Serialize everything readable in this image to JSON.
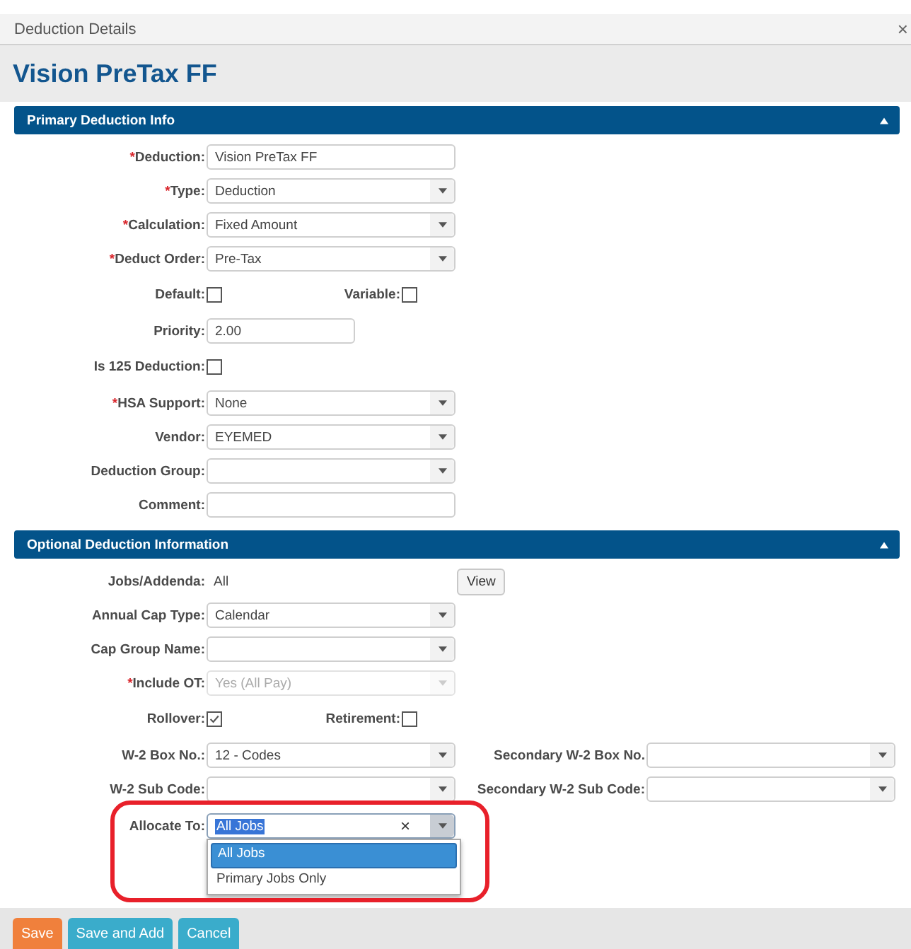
{
  "dialog": {
    "title": "Deduction Details",
    "close": "×"
  },
  "header": "Vision PreTax FF",
  "sections": [
    {
      "title": "Primary Deduction Info",
      "expanded": true,
      "rows": [
        {
          "kind": "text",
          "label": "Deduction:",
          "required_mark": "*",
          "value": "Vision PreTax FF"
        },
        {
          "kind": "select",
          "label": "Type:",
          "required_mark": "*",
          "value": "Deduction"
        },
        {
          "kind": "select",
          "label": "Calculation:",
          "required_mark": "*",
          "value": "Fixed Amount"
        },
        {
          "kind": "select",
          "label": "Deduct Order:",
          "required_mark": "*",
          "value": "Pre-Tax"
        },
        {
          "kind": "checks",
          "items": [
            {
              "label": "Default:",
              "checked": false
            },
            {
              "label": "Variable:",
              "checked": false
            }
          ]
        },
        {
          "kind": "short_text",
          "label": "Priority:",
          "value": "2.00"
        },
        {
          "kind": "checks",
          "items": [
            {
              "label": "Is 125 Deduction:",
              "checked": false
            }
          ]
        },
        {
          "kind": "select",
          "label": "HSA Support:",
          "required_mark": "*",
          "value": "None"
        },
        {
          "kind": "select",
          "label": "Vendor:",
          "value": "EYEMED"
        },
        {
          "kind": "select",
          "label": "Deduction Group:"
        },
        {
          "kind": "text",
          "label": "Comment:"
        }
      ]
    },
    {
      "title": "Optional Deduction Information",
      "expanded": true,
      "rows": [
        {
          "kind": "info",
          "label": "Jobs/Addenda:",
          "value": "All",
          "button": "View"
        },
        {
          "kind": "select",
          "label": "Annual Cap Type:",
          "value": "Calendar"
        },
        {
          "kind": "select",
          "label": "Cap Group Name:"
        },
        {
          "kind": "select",
          "label": "Include OT:",
          "required_mark": "*",
          "value": "Yes (All Pay)",
          "disabled": true
        },
        {
          "kind": "checks",
          "items": [
            {
              "label": "Rollover:",
              "checked": true
            },
            {
              "label": "Retirement:",
              "checked": false
            }
          ]
        },
        {
          "kind": "select",
          "label": "W-2 Box No.:",
          "value": "12 - Codes",
          "secondary": {
            "label": "Secondary W-2 Box No."
          }
        },
        {
          "kind": "select",
          "label": "W-2 Sub Code:",
          "secondary": {
            "label": "Secondary W-2 Sub Code:"
          }
        },
        {
          "kind": "combo",
          "label": "Allocate To:",
          "value": "All Jobs",
          "clear": "×",
          "outlined": true,
          "options": [
            {
              "label": "All Jobs",
              "selected": true
            },
            {
              "label": "Primary Jobs Only",
              "selected": false
            }
          ]
        }
      ]
    }
  ],
  "buttons": [
    {
      "label": "Save",
      "color": "#f0803c"
    },
    {
      "label": "Save and Add",
      "color": "#3aaccb"
    },
    {
      "label": "Cancel",
      "color": "#3aaccb"
    }
  ]
}
